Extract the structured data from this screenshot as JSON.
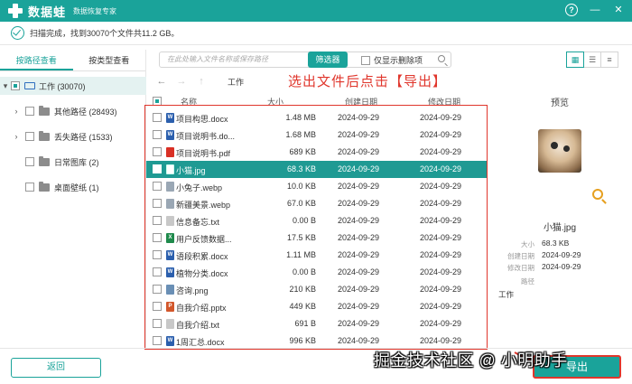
{
  "titlebar": {
    "app_name": "数据蛙",
    "subtitle": "数据恢复专家",
    "help": "?",
    "minimize": "—",
    "close": "✕"
  },
  "status": {
    "text": "扫描完成，找到30070个文件共11.2 GB。"
  },
  "sidebar": {
    "tabs": [
      "按路径查看",
      "按类型查看"
    ],
    "tree": [
      {
        "label": "工作 (30070)",
        "expanded": true
      },
      {
        "label": "其他路径 (28493)"
      },
      {
        "label": "丢失路径 (1533)"
      },
      {
        "label": "日常图库 (2)"
      },
      {
        "label": "桌面壁纸 (1)"
      }
    ]
  },
  "toolbar": {
    "search_placeholder": "在此处输入文件名称或保存路径",
    "filter_label": "筛选器",
    "deleted_only_label": "仅显示删除项"
  },
  "nav": {
    "back": "←",
    "forward": "→",
    "up": "↑",
    "path": "工作"
  },
  "annotation": "选出文件后点击【导出】",
  "columns": {
    "name": "名称",
    "size": "大小",
    "created": "创建日期",
    "modified": "修改日期"
  },
  "files": [
    {
      "name": "项目构思.docx",
      "size": "1.48 MB",
      "created": "2024-09-29",
      "modified": "2024-09-29",
      "icon": "W",
      "icon_color": "#2b5fad"
    },
    {
      "name": "项目说明书.do...",
      "size": "1.68 MB",
      "created": "2024-09-29",
      "modified": "2024-09-29",
      "icon": "W",
      "icon_color": "#2b5fad"
    },
    {
      "name": "项目说明书.pdf",
      "size": "689 KB",
      "created": "2024-09-29",
      "modified": "2024-09-29",
      "icon": "",
      "icon_color": "#d93025"
    },
    {
      "name": "小猫.jpg",
      "size": "68.3 KB",
      "created": "2024-09-29",
      "modified": "2024-09-29",
      "icon": "",
      "icon_color": "#ffffff",
      "selected": true
    },
    {
      "name": "小兔子.webp",
      "size": "10.0 KB",
      "created": "2024-09-29",
      "modified": "2024-09-29",
      "icon": "",
      "icon_color": "#9aa7b4"
    },
    {
      "name": "新疆美景.webp",
      "size": "67.0 KB",
      "created": "2024-09-29",
      "modified": "2024-09-29",
      "icon": "",
      "icon_color": "#9aa7b4"
    },
    {
      "name": "信息备忘.txt",
      "size": "0.00 B",
      "created": "2024-09-29",
      "modified": "2024-09-29",
      "icon": "",
      "icon_color": "#c8c8c8"
    },
    {
      "name": "用户反馈数据...",
      "size": "17.5 KB",
      "created": "2024-09-29",
      "modified": "2024-09-29",
      "icon": "X",
      "icon_color": "#1f8a4c"
    },
    {
      "name": "语段积累.docx",
      "size": "1.11 MB",
      "created": "2024-09-29",
      "modified": "2024-09-29",
      "icon": "W",
      "icon_color": "#2b5fad"
    },
    {
      "name": "植物分类.docx",
      "size": "0.00 B",
      "created": "2024-09-29",
      "modified": "2024-09-29",
      "icon": "W",
      "icon_color": "#2b5fad"
    },
    {
      "name": "咨询.png",
      "size": "210 KB",
      "created": "2024-09-29",
      "modified": "2024-09-29",
      "icon": "",
      "icon_color": "#6a8fb5"
    },
    {
      "name": "自我介绍.pptx",
      "size": "449 KB",
      "created": "2024-09-29",
      "modified": "2024-09-29",
      "icon": "P",
      "icon_color": "#d2572b"
    },
    {
      "name": "自我介绍.txt",
      "size": "691 B",
      "created": "2024-09-29",
      "modified": "2024-09-29",
      "icon": "",
      "icon_color": "#c8c8c8"
    },
    {
      "name": "1周汇总.docx",
      "size": "996 KB",
      "created": "2024-09-29",
      "modified": "2024-09-29",
      "icon": "W",
      "icon_color": "#2b5fad"
    }
  ],
  "preview": {
    "title": "预览",
    "file_name": "小猫.jpg",
    "size_label": "大小",
    "size": "68.3 KB",
    "created_label": "创建日期",
    "created": "2024-09-29",
    "modified_label": "修改日期",
    "modified": "2024-09-29",
    "path_label": "路径",
    "path": "工作"
  },
  "footer": {
    "back_label": "返回",
    "export_label": "导出",
    "watermark": "掘金技术社区 @ 小明助手"
  },
  "colors": {
    "accent": "#1aa39a",
    "annotation_red": "#e0362c"
  }
}
